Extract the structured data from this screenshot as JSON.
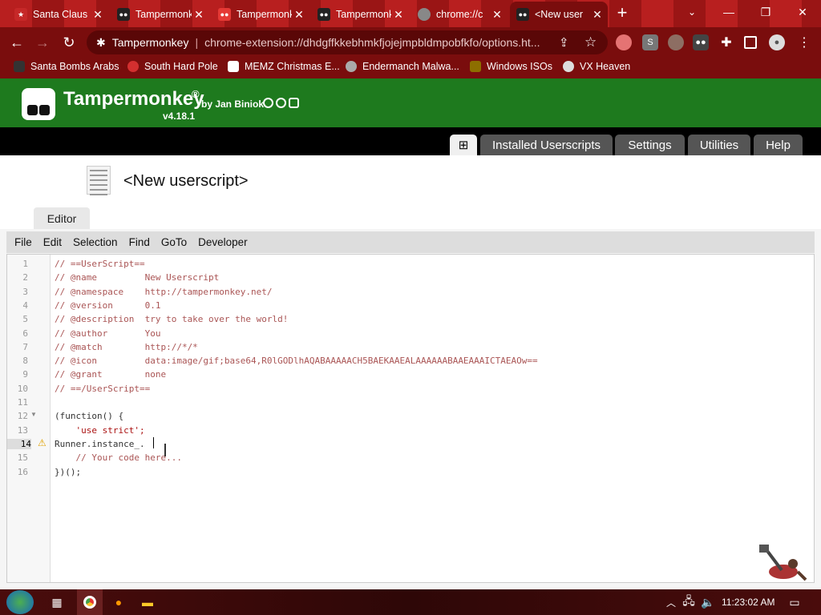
{
  "browser": {
    "tabs": [
      {
        "title": "Santa Claus",
        "color": "#c62828"
      },
      {
        "title": "Tampermonkey",
        "color": "#222222"
      },
      {
        "title": "Tampermonkey",
        "color": "#e53935"
      },
      {
        "title": "Tampermonkey",
        "color": "#222222"
      },
      {
        "title": "chrome://c",
        "color": "#888888"
      },
      {
        "title": "<New user",
        "color": "#222222"
      }
    ],
    "omnibox": {
      "site": "Tampermonkey",
      "url": "chrome-extension://dhdgffkkebhmkfjojejmpbldmpobfkfo/options.ht..."
    },
    "bookmarks": [
      "Santa Bombs Arabs",
      "South Hard Pole",
      "MEMZ Christmas E...",
      "Endermanch Malwa...",
      "Windows ISOs",
      "VX Heaven"
    ]
  },
  "tampermonkey": {
    "title": "Tampermonkey",
    "registered": "®",
    "by": "by Jan Biniok",
    "version": "v4.18.1",
    "nav_tabs": [
      "⊞",
      "Installed Userscripts",
      "Settings",
      "Utilities",
      "Help"
    ],
    "script_title": "<New userscript>",
    "editor_tab": "Editor",
    "menu": [
      "File",
      "Edit",
      "Selection",
      "Find",
      "GoTo",
      "Developer"
    ],
    "code_lines": [
      "// ==UserScript==",
      "// @name         New Userscript",
      "// @namespace    http://tampermonkey.net/",
      "// @version      0.1",
      "// @description  try to take over the world!",
      "// @author       You",
      "// @match        http://*/*",
      "// @icon         data:image/gif;base64,R0lGODlhAQABAAAAACH5BAEKAAEALAAAAAABAAEAAAICTAEAOw==",
      "// @grant        none",
      "// ==/UserScript==",
      "",
      "(function() {",
      "    'use strict';",
      "Runner.instance_.",
      "    // Your code here...",
      "})();"
    ],
    "current_line": 14,
    "warning_line": 14,
    "fold_line": 12
  },
  "taskbar": {
    "clock": "11:23:02 AM"
  },
  "colors": {
    "tab_strip": "#a31a1a",
    "toolbar": "#7a0d0d",
    "tm_green": "#1e7a1e"
  }
}
